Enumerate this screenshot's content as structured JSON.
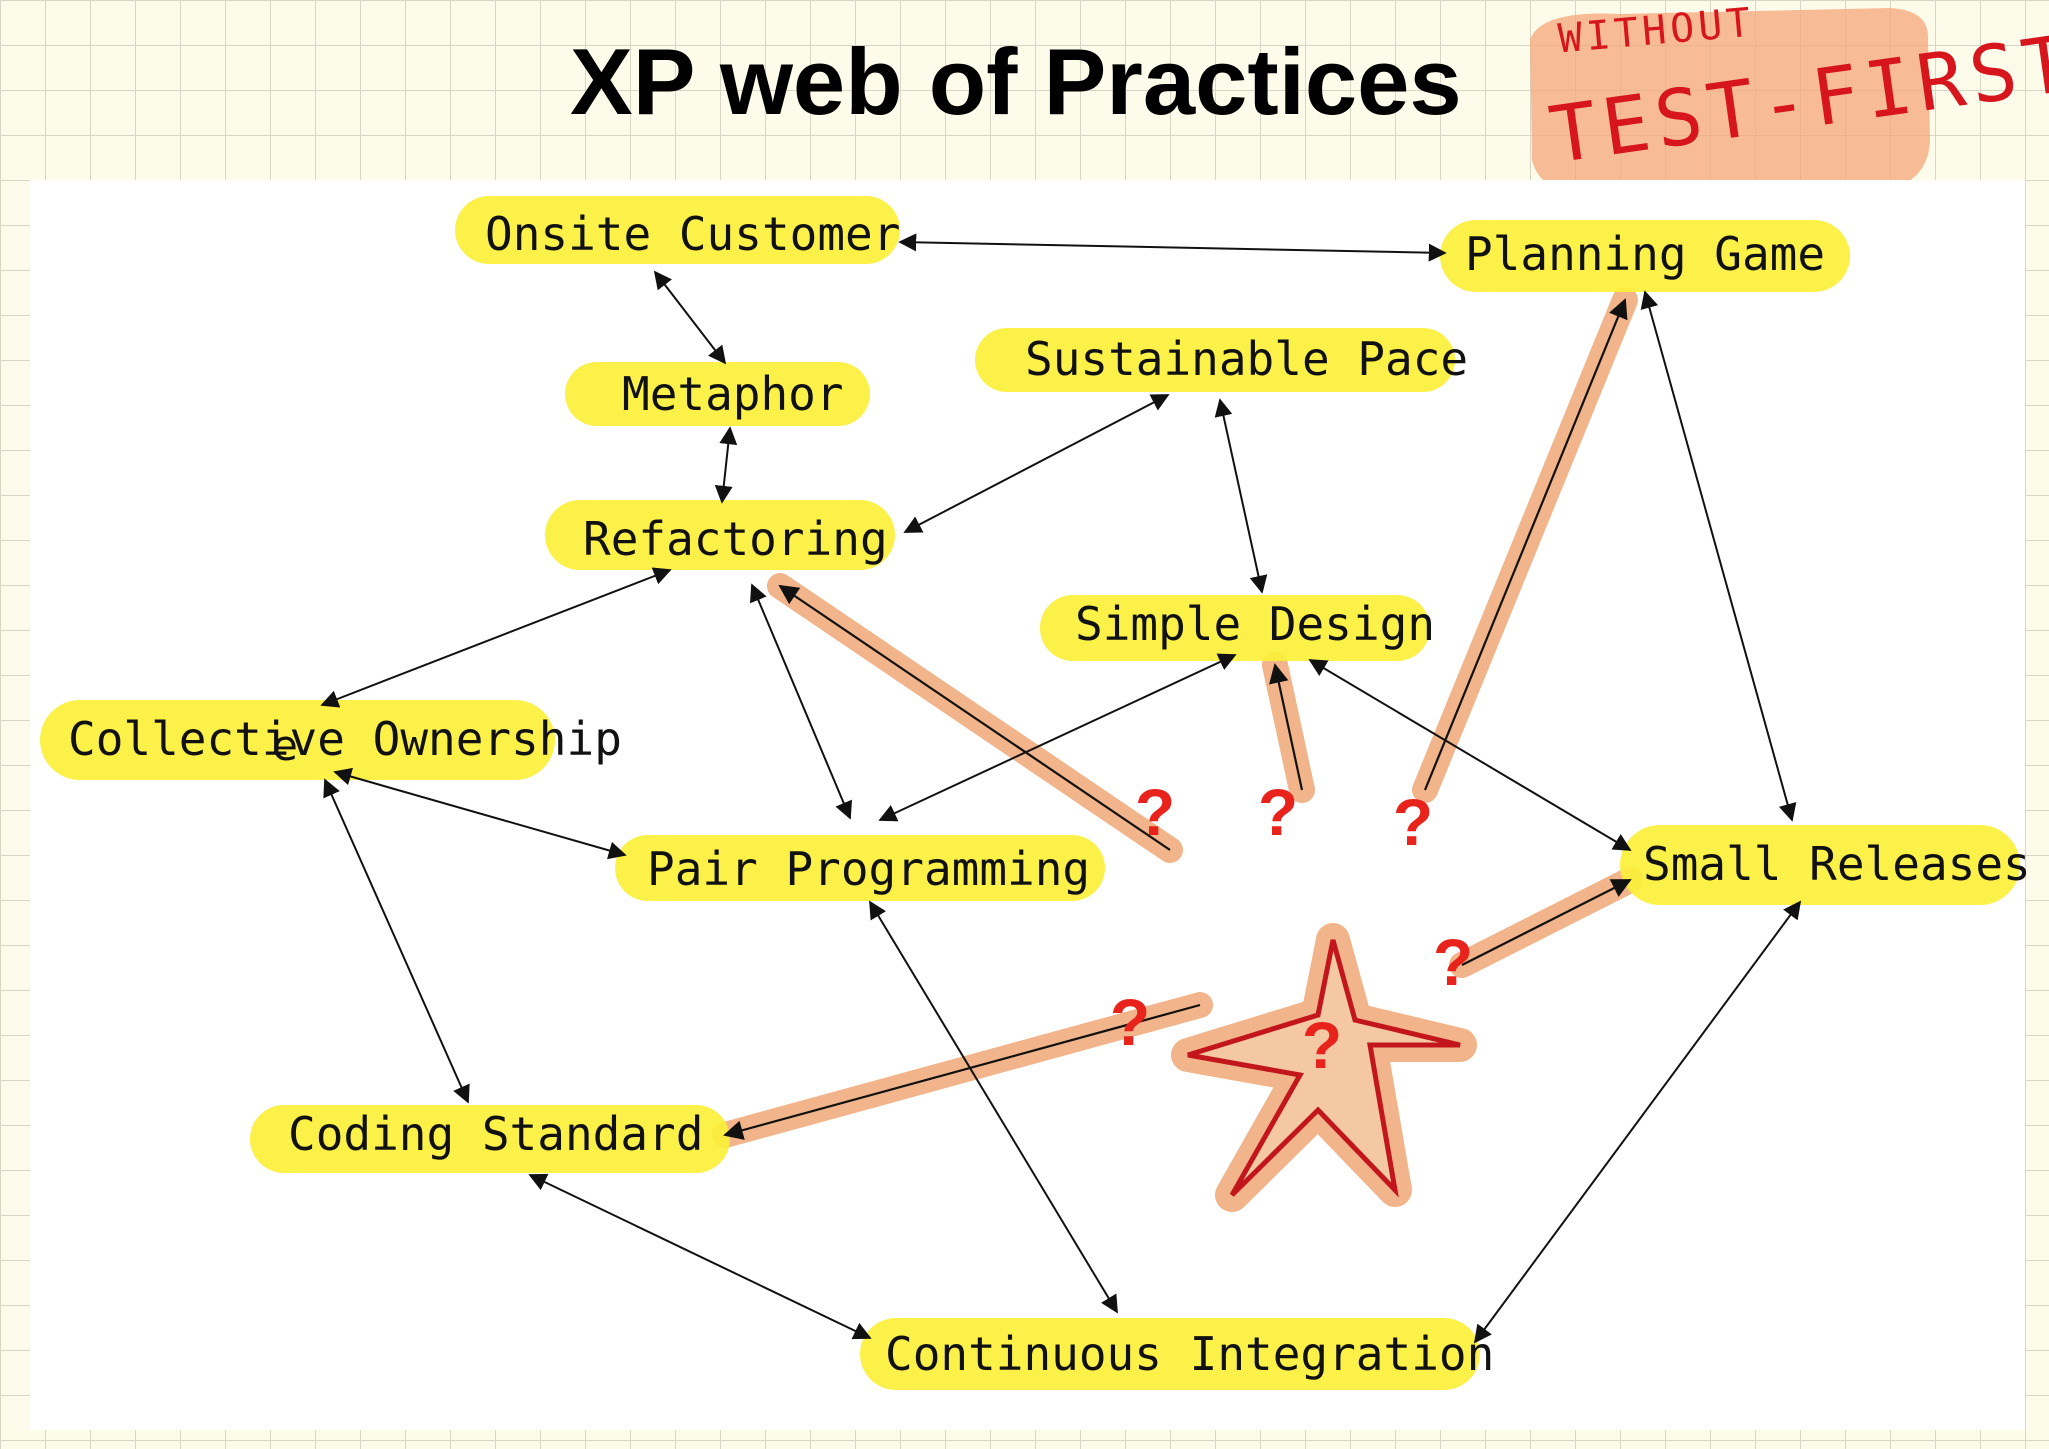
{
  "title": "XP web of Practices",
  "annotation": {
    "line1": "WITHOUT",
    "line2": "TEST-FIRST",
    "color": "#d6151c",
    "highlight_color": "#f4a77a"
  },
  "colors": {
    "node_highlight": "#fbf03a",
    "missing_link_highlight": "#f2b48a",
    "question_mark": "#e8231c",
    "star_outline": "#c3161c",
    "star_fill": "#f4c8a2",
    "arrow": "#111111"
  },
  "nodes": [
    {
      "id": "onsite",
      "label": "Onsite Customer"
    },
    {
      "id": "planning",
      "label": "Planning Game"
    },
    {
      "id": "metaphor",
      "label": "Metaphor"
    },
    {
      "id": "pace",
      "label": "Sustainable Pace"
    },
    {
      "id": "refactoring",
      "label": "Refactoring"
    },
    {
      "id": "simple",
      "label": "Simple Design"
    },
    {
      "id": "collective",
      "label": "Collective Ownership"
    },
    {
      "id": "pair",
      "label": "Pair Programming"
    },
    {
      "id": "small",
      "label": "Small Releases"
    },
    {
      "id": "coding",
      "label": "Coding Standard"
    },
    {
      "id": "ci",
      "label": "Continuous Integration"
    }
  ],
  "edges": [
    {
      "from": "onsite",
      "to": "planning",
      "bidirectional": true
    },
    {
      "from": "onsite",
      "to": "metaphor",
      "bidirectional": true
    },
    {
      "from": "metaphor",
      "to": "refactoring",
      "bidirectional": true
    },
    {
      "from": "pace",
      "to": "refactoring",
      "bidirectional": true
    },
    {
      "from": "pace",
      "to": "simple",
      "bidirectional": true
    },
    {
      "from": "refactoring",
      "to": "collective",
      "bidirectional": true
    },
    {
      "from": "refactoring",
      "to": "pair",
      "bidirectional": true
    },
    {
      "from": "simple",
      "to": "pair",
      "bidirectional": true
    },
    {
      "from": "simple",
      "to": "small",
      "bidirectional": true
    },
    {
      "from": "planning",
      "to": "small",
      "bidirectional": true
    },
    {
      "from": "collective",
      "to": "pair",
      "bidirectional": true
    },
    {
      "from": "collective",
      "to": "coding",
      "bidirectional": true
    },
    {
      "from": "pair",
      "to": "ci",
      "bidirectional": true
    },
    {
      "from": "coding",
      "to": "ci",
      "bidirectional": true
    },
    {
      "from": "small",
      "to": "ci",
      "bidirectional": true
    }
  ],
  "missing_links": [
    {
      "target": "refactoring",
      "label": "?"
    },
    {
      "target": "simple",
      "label": "?"
    },
    {
      "target": "planning",
      "label": "?"
    },
    {
      "target": "small",
      "label": "?"
    },
    {
      "target": "coding",
      "label": "?"
    }
  ],
  "missing_practice": {
    "label": "?"
  },
  "stray_mark": "e"
}
